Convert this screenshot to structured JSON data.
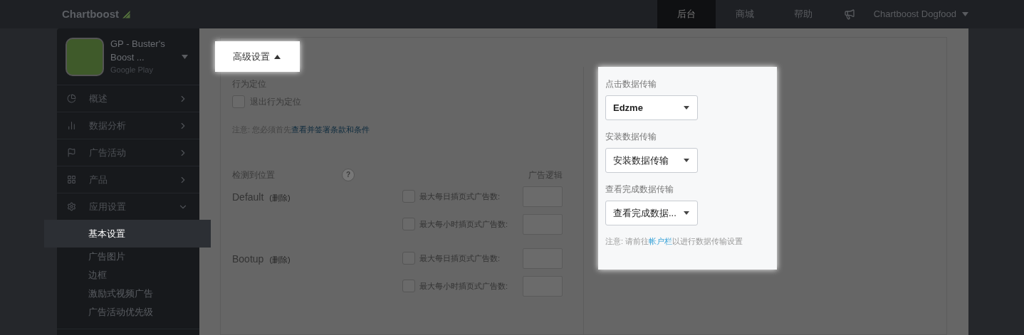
{
  "topbar": {
    "logo": "Chartboost",
    "nav": [
      {
        "label": "后台",
        "selected": true
      },
      {
        "label": "商城",
        "selected": false
      },
      {
        "label": "帮助",
        "selected": false
      }
    ],
    "account": "Chartboost Dogfood"
  },
  "sidebar": {
    "app": {
      "name": "GP - Buster's Boost ...",
      "platform": "Google Play"
    },
    "items": [
      {
        "label": "概述",
        "expanded": false
      },
      {
        "label": "数据分析",
        "expanded": false
      },
      {
        "label": "广告活动",
        "expanded": false
      },
      {
        "label": "产品",
        "expanded": false
      },
      {
        "label": "应用设置",
        "expanded": true,
        "children": [
          {
            "label": "基本设置",
            "selected": true
          },
          {
            "label": "广告图片",
            "selected": false
          },
          {
            "label": "边框",
            "selected": false
          },
          {
            "label": "激励式视频广告",
            "selected": false
          },
          {
            "label": "广告活动优先级",
            "selected": false
          }
        ]
      }
    ]
  },
  "section": {
    "title": "高级设置",
    "expanded": true
  },
  "behavior": {
    "heading": "行为定位",
    "opt_out": {
      "label": "退出行为定位",
      "checked": false
    },
    "note": "注意: 您必须首先",
    "note_link": "查看并签署条款和条件"
  },
  "locations": {
    "heading": "检测到位置",
    "help": "?",
    "logic_heading": "广告逻辑",
    "rows": [
      {
        "name": "Default",
        "delete": "(删除)",
        "limits": [
          {
            "label": "最大每日插页式广告数:",
            "checked": false
          },
          {
            "label": "最大每小时插页式广告数:",
            "checked": false
          }
        ]
      },
      {
        "name": "Bootup",
        "delete": "(删除)",
        "limits": [
          {
            "label": "最大每日插页式广告数:",
            "checked": false
          },
          {
            "label": "最大每小时插页式广告数:",
            "checked": false
          }
        ]
      }
    ]
  },
  "postbacks": {
    "fields": [
      {
        "label": "点击数据传输",
        "value": "Edzme",
        "kind": "chosen"
      },
      {
        "label": "安装数据传输",
        "value": "安装数据传输",
        "kind": "prompt"
      },
      {
        "label": "查看完成数据传输",
        "value": "查看完成数据...",
        "kind": "prompt"
      }
    ],
    "note": "注意: 请前往",
    "note_link": "帐户栏",
    "note_end": "以进行数据传输设置"
  }
}
